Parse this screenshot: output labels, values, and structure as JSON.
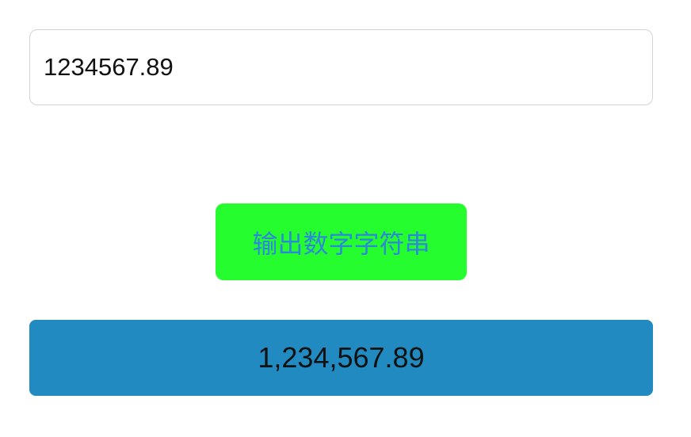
{
  "input": {
    "value": "1234567.89"
  },
  "button": {
    "label": "输出数字字符串"
  },
  "result": {
    "text": "1,234,567.89"
  },
  "colors": {
    "button_background": "#26fd2f",
    "button_text": "#2a8ad8",
    "result_background": "#208ac1",
    "input_border": "#d4d4d4"
  }
}
